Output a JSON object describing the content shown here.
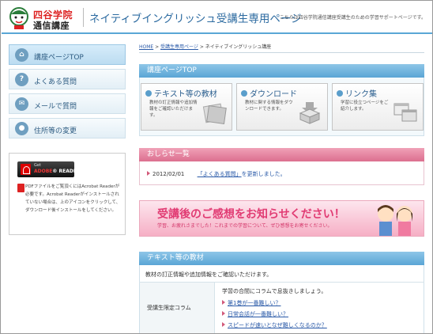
{
  "header": {
    "logo_line1": "四谷学院",
    "logo_line2": "通信講座",
    "title": "ネイティブイングリッシュ受講生専用ページ",
    "tagline": "こちらは四谷学院通信講座受講生のための学習サポートページです。"
  },
  "sidebar": {
    "items": [
      {
        "label": "講座ページTOP",
        "icon": "home-icon",
        "glyph": "⌂"
      },
      {
        "label": "よくある質問",
        "icon": "question-icon",
        "glyph": "?"
      },
      {
        "label": "メールで質問",
        "icon": "mail-icon",
        "glyph": "✉"
      },
      {
        "label": "住所等の変更",
        "icon": "person-icon",
        "glyph": "●"
      }
    ],
    "adobe": {
      "badge_small": "Get",
      "badge_word1": "ADOBE",
      "badge_word2": "® READER",
      "text": "PDFファイルをご覧頂くにはAcrobat Readerが必要です。Acrobat Readerがインストールされていない場合は、上のアイコンをクリックして、ダウンロード後インストールをしてください。"
    }
  },
  "breadcrumb": {
    "home": "HOME",
    "sep": " > ",
    "level2": "受講生専用ページ",
    "current": "ネイティブイングリッシュ講座"
  },
  "top_section": {
    "title": "講座ページTOP",
    "cards": [
      {
        "title": "テキスト等の教材",
        "desc": "教材の訂正情報や追加情報をご確認いただけます。"
      },
      {
        "title": "ダウンロード",
        "desc": "教材に関する情報をダウンロードできます。"
      },
      {
        "title": "リンク集",
        "desc": "学習に役立つページをご紹介します。"
      }
    ]
  },
  "news": {
    "title": "おしらせ一覧",
    "items": [
      {
        "date": "2012/02/01",
        "link_text": "「よくある質問」",
        "suffix": "を更新しました。"
      }
    ]
  },
  "banner": {
    "title": "受講後のご感想をお知らせください！",
    "subtitle": "学習、お疲れさまでした！これまでの学習について、ぜひ感想をお寄せください。"
  },
  "text_section": {
    "title": "テキスト等の教材",
    "note": "教材の訂正情報や追加情報をご確認いただけます。",
    "column_label": "受講生限定コラム",
    "column_intro": "学習の合間にコラムで息抜きしましょう。",
    "links": [
      "第1巻が一番難しい？",
      "日常会話が一番難しい？",
      "スピードが速いとなぜ難しくなるのか？"
    ]
  },
  "colors": {
    "accent_blue": "#5aa5d5",
    "accent_pink": "#dc6f8f",
    "link": "#2a5aa8"
  }
}
